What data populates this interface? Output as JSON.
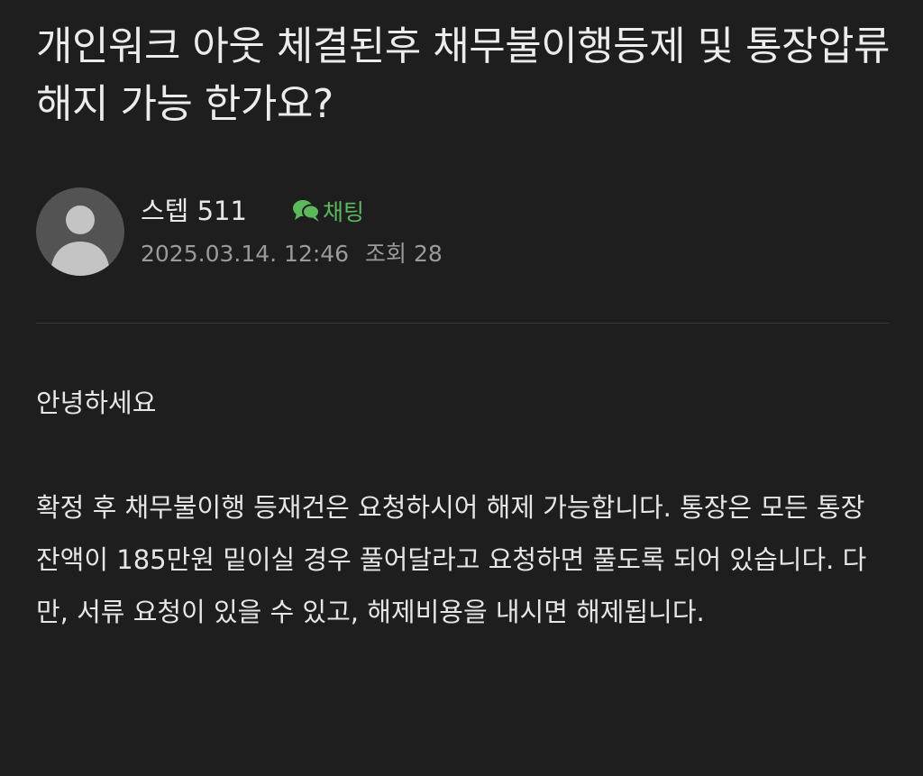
{
  "post": {
    "title": "개인워크 아웃 체결된후 채무불이행등제 및 통장압류 해지 가능 한가요?",
    "author": {
      "name": "스텝 511",
      "chat_label": "채팅",
      "avatar_icon": "user-silhouette-icon"
    },
    "meta": {
      "date": "2025.03.14. 12:46",
      "views": "조회 28"
    },
    "body": {
      "greeting": "안녕하세요",
      "paragraph": "확정 후 채무불이행 등재건은 요청하시어 해제 가능합니다. 통장은 모든 통장 잔액이 185만원 밑이실 경우 풀어달라고 요청하면 풀도록 되어 있습니다. 다만, 서류 요청이 있을 수 있고, 해제비용을 내시면 해제됩니다."
    }
  },
  "colors": {
    "background": "#1e1e1e",
    "text": "#e8e8e8",
    "muted": "#9a9a9a",
    "accent": "#5cb85c"
  }
}
